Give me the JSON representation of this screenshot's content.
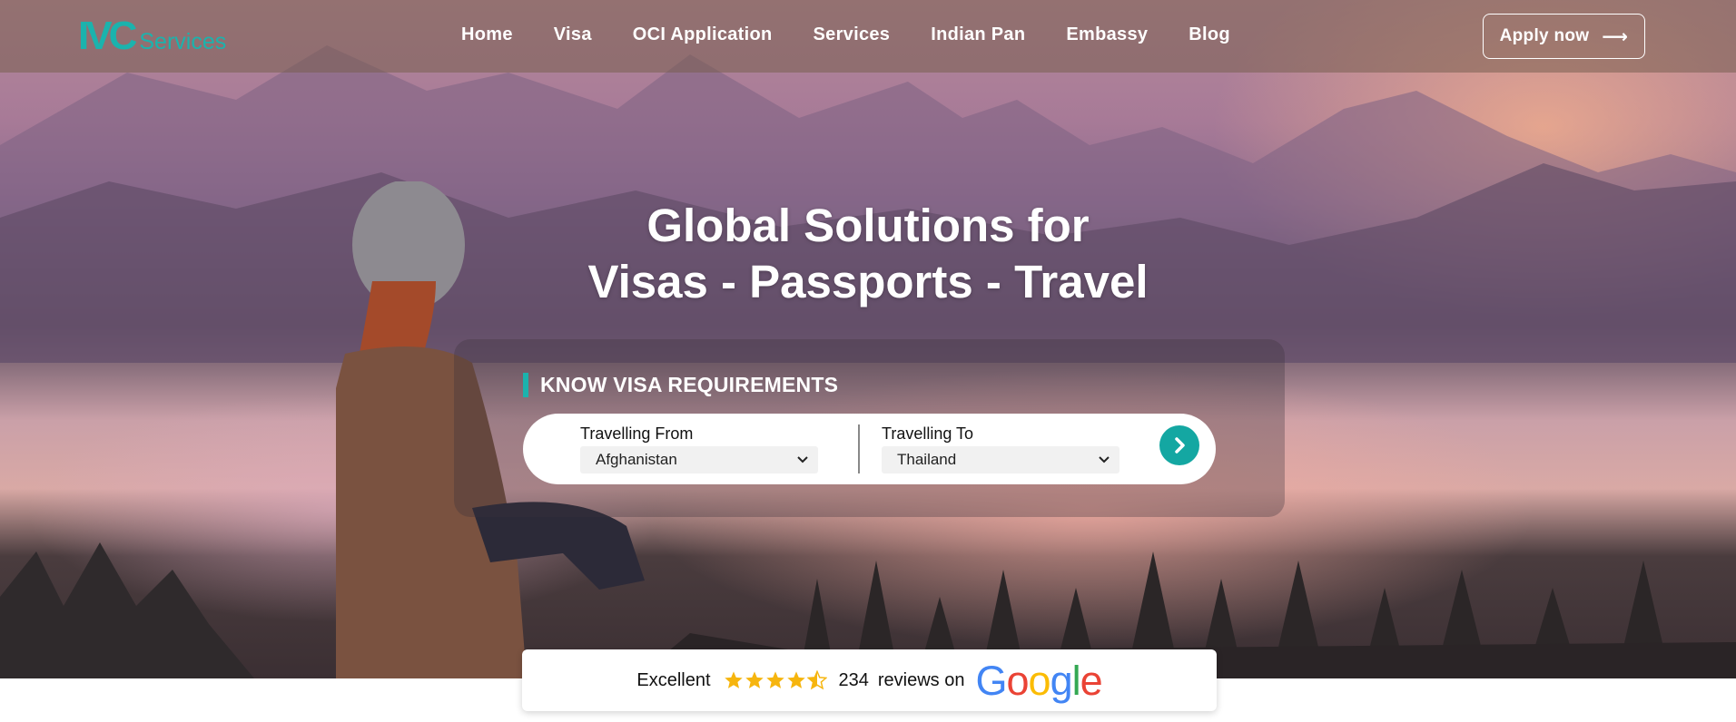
{
  "header": {
    "logo_mark": "IVC",
    "logo_text": "Services",
    "nav": [
      "Home",
      "Visa",
      "OCI Application",
      "Services",
      "Indian Pan",
      "Embassy",
      "Blog"
    ],
    "apply_label": "Apply now"
  },
  "hero": {
    "headline_line1": "Global Solutions for",
    "headline_line2": "Visas - Passports - Travel"
  },
  "visa_search": {
    "heading": "KNOW VISA REQUIREMENTS",
    "from_label": "Travelling From",
    "from_value": "Afghanistan",
    "to_label": "Travelling To",
    "to_value": "Thailand",
    "submit_icon": "chevron-right-circle-icon"
  },
  "reviews": {
    "rating_text": "Excellent",
    "stars": 4.5,
    "count": "234",
    "suffix": "reviews on",
    "platform": "Google"
  },
  "colors": {
    "accent": "#1bb3ad",
    "header_bg": "rgba(120,95,80,0.55)"
  }
}
